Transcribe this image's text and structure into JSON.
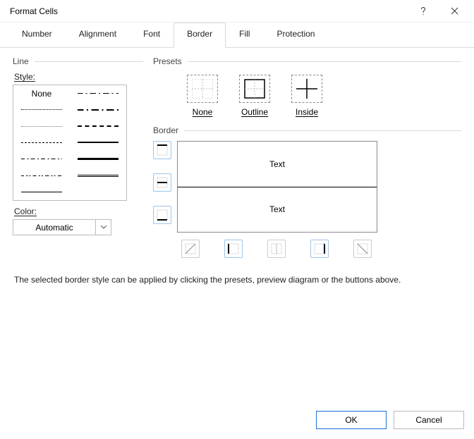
{
  "title": "Format Cells",
  "tabs": [
    "Number",
    "Alignment",
    "Font",
    "Border",
    "Fill",
    "Protection"
  ],
  "activeTab": 3,
  "line": {
    "group": "Line",
    "styleLabel": "Style:",
    "noneLabel": "None",
    "colorLabel": "Color:",
    "colorValue": "Automatic"
  },
  "presets": {
    "group": "Presets",
    "none": "None",
    "outline": "Outline",
    "inside": "Inside"
  },
  "border": {
    "group": "Border",
    "previewText": "Text"
  },
  "hint": "The selected border style can be applied by clicking the presets, preview diagram or the buttons above.",
  "buttons": {
    "ok": "OK",
    "cancel": "Cancel"
  }
}
